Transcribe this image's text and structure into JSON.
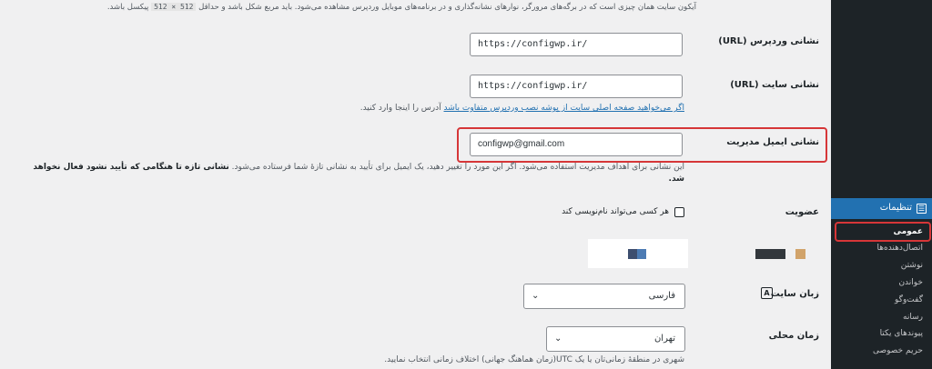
{
  "icon_note": {
    "text_before": "آیکون سایت همان چیزی است که در برگه‌های مرورگر، نوارهای نشانه‌گذاری و در برنامه‌های موبایل وردپرس مشاهده می‌شود. باید مربع شکل باشد و حداقل",
    "code": "512 × 512",
    "text_after": "پیکسل باشد."
  },
  "fields": {
    "wp_url": {
      "label": "نشانی وردپرس (URL)",
      "value": "https://configwp.ir/"
    },
    "site_url": {
      "label": "نشانی سایت (URL)",
      "value": "https://configwp.ir/",
      "help_link": "اگر می‌خواهید صفحه اصلی سایت از پوشه نصب وردپرس متفاوت باشد",
      "help_after": "آدرس را اینجا وارد کنید."
    },
    "admin_email": {
      "label": "نشانی ایمیل مدیریت",
      "value": "configwp@gmail.com",
      "help_normal": "این نشانی برای اهداف مدیریت استفاده می‌شود. اگر این مورد را تغییر دهید، یک ایمیل برای تأیید به نشانی تازهٔ شما فرستاده می‌شود.",
      "help_bold": "نشانی تازه تا هنگامی که تأیید نشود فعال نخواهد شد."
    },
    "membership": {
      "label": "عضویت",
      "checkbox_label": "هر کسی می‌تواند نام‌نویسی کند",
      "checked": false
    },
    "site_language": {
      "label": "زبان سایت",
      "selected": "فارسی"
    },
    "timezone": {
      "label": "زمان محلی",
      "selected": "تهران",
      "help": "شهری در منطقهٔ زمانی‌تان یا یک UTC(زمان هماهنگ جهانی) اختلاف زمانی انتخاب نمایید."
    }
  },
  "sidebar": {
    "parent": "تنظیمات",
    "items": [
      {
        "label": "عمومی",
        "current": true
      },
      {
        "label": "اتصال‌دهنده‌ها"
      },
      {
        "label": "نوشتن"
      },
      {
        "label": "خواندن"
      },
      {
        "label": "گفت‌وگو"
      },
      {
        "label": "رسانه"
      },
      {
        "label": "پیوندهای یکتا"
      },
      {
        "label": "حریم خصوصی"
      }
    ]
  },
  "colors": {
    "accent": "#2271b1",
    "highlight": "#d63638",
    "sidebar_bg": "#1d2327"
  }
}
